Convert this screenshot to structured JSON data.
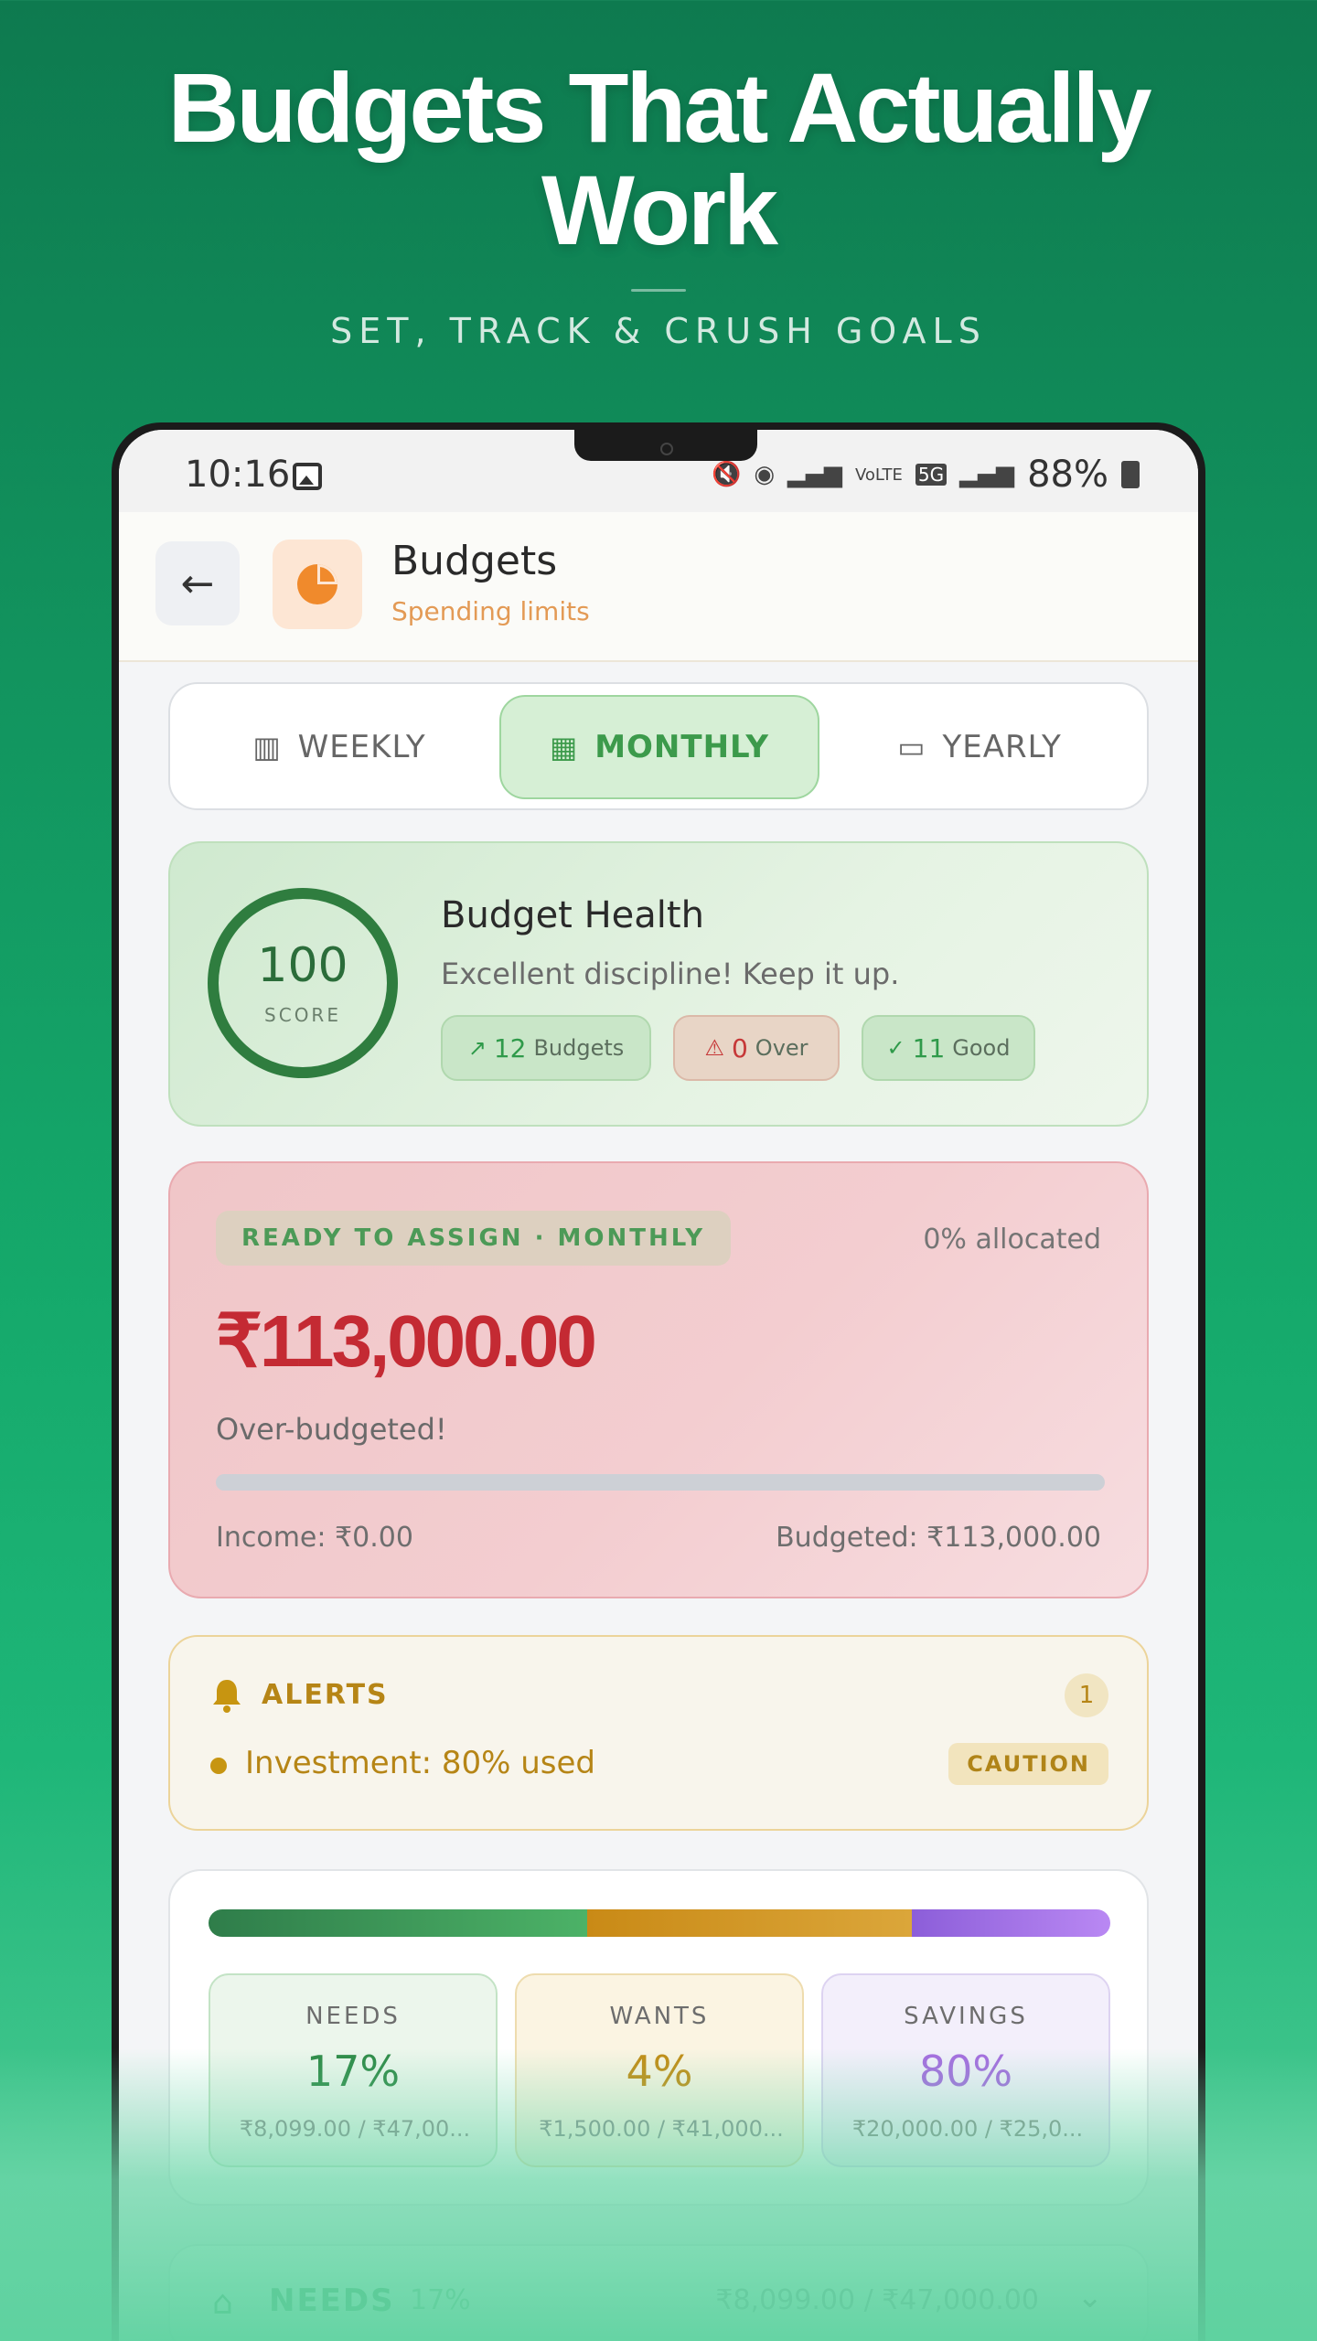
{
  "hero": {
    "title_line1": "Budgets That Actually",
    "title_line2": "Work",
    "subtitle": "SET, TRACK & CRUSH GOALS"
  },
  "status_bar": {
    "time": "10:16",
    "carrier": "VoLTE",
    "network": "5G",
    "battery": "88%"
  },
  "app_bar": {
    "title": "Budgets",
    "subtitle": "Spending limits"
  },
  "period_tabs": [
    {
      "label": "WEEKLY",
      "icon": "columns-icon",
      "selected": false
    },
    {
      "label": "MONTHLY",
      "icon": "calendar-icon",
      "selected": true
    },
    {
      "label": "YEARLY",
      "icon": "calendar-icon",
      "selected": false
    }
  ],
  "health": {
    "score": "100",
    "score_label": "SCORE",
    "score_fraction": 1.0,
    "title": "Budget Health",
    "description": "Excellent discipline! Keep it up.",
    "chips": {
      "budgets_count": "12",
      "budgets_label": "Budgets",
      "over_count": "0",
      "over_label": "Over",
      "good_count": "11",
      "good_label": "Good"
    }
  },
  "assign": {
    "pill": "READY TO ASSIGN · MONTHLY",
    "allocated": "0% allocated",
    "amount": "₹113,000.00",
    "status": "Over-budgeted!",
    "progress": 0,
    "income": "Income: ₹0.00",
    "budgeted": "Budgeted: ₹113,000.00"
  },
  "alerts": {
    "title": "ALERTS",
    "count": "1",
    "items": [
      {
        "text": "Investment: 80% used",
        "badge": "CAUTION"
      }
    ]
  },
  "split": {
    "bar_fractions": {
      "needs": 0.42,
      "wants": 0.36,
      "savings": 0.22
    },
    "boxes": [
      {
        "label": "NEEDS",
        "pct": "17%",
        "amount": "₹8,099.00 / ₹47,00..."
      },
      {
        "label": "WANTS",
        "pct": "4%",
        "amount": "₹1,500.00 / ₹41,000..."
      },
      {
        "label": "SAVINGS",
        "pct": "80%",
        "amount": "₹20,000.00 / ₹25,0..."
      }
    ]
  },
  "needs_row": {
    "name": "NEEDS",
    "pct": "17%",
    "amount": "₹8,099.00 / ₹47,000.00"
  },
  "colors": {
    "brand_green": "#15a96b",
    "over_red": "#c42a33",
    "caution_amber": "#b68516",
    "savings_purple": "#a66ce0"
  }
}
